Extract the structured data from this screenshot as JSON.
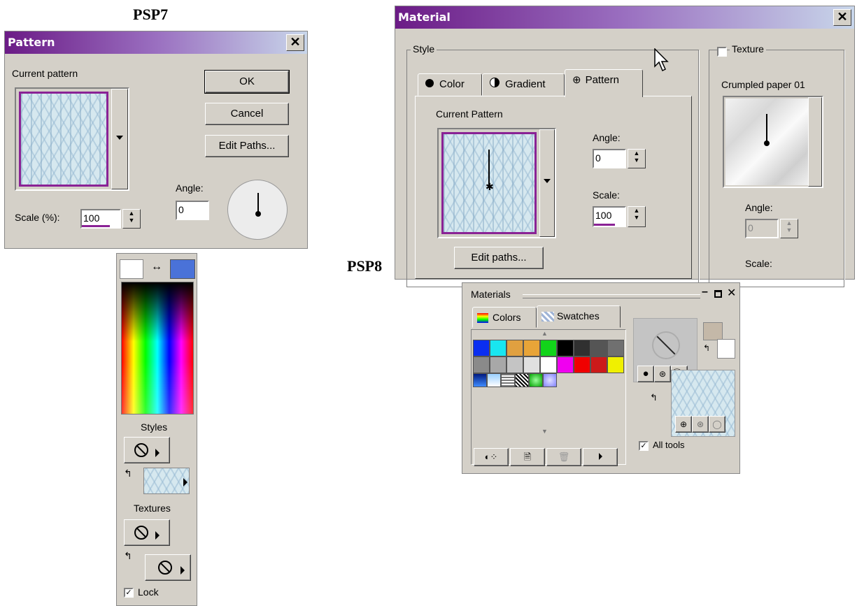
{
  "captions": {
    "psp7": "PSP7",
    "psp8": "PSP8"
  },
  "pattern_dialog": {
    "title": "Pattern",
    "current_pattern_label": "Current pattern",
    "ok": "OK",
    "cancel": "Cancel",
    "edit_paths": "Edit Paths...",
    "angle_label": "Angle:",
    "angle_value": "0",
    "scale_label": "Scale (%):",
    "scale_value": "100"
  },
  "psp7_palette": {
    "swap_icon": "↔",
    "styles_label": "Styles",
    "textures_label": "Textures",
    "lock_label": "Lock",
    "lock_checked": true,
    "fg_color": "#ffffff",
    "bg_color": "#4a72d8"
  },
  "material_dialog": {
    "title": "Material",
    "style_group": "Style",
    "tabs": [
      "Color",
      "Gradient",
      "Pattern"
    ],
    "active_tab": "Pattern",
    "current_pattern_label": "Current Pattern",
    "angle_label": "Angle:",
    "angle_value": "0",
    "scale_label": "Scale:",
    "scale_value": "100",
    "edit_paths": "Edit paths...",
    "texture_label": "Texture",
    "texture_checked": false,
    "texture_name": "Crumpled paper 01",
    "texture_angle_label": "Angle:",
    "texture_angle_value": "0",
    "texture_scale_label": "Scale:"
  },
  "materials_palette": {
    "title": "Materials",
    "tabs": [
      "Colors",
      "Swatches"
    ],
    "active_tab": "Swatches",
    "all_tools_label": "All tools",
    "all_tools_checked": true,
    "swatch_rows": [
      [
        "#0a2ef0",
        "#19e6f0",
        "#e0a040",
        "#e8a438",
        "#12d41a",
        "#000000",
        "#303030",
        "#555555",
        "#707070"
      ],
      [
        "#8a8a8a",
        "#a8a8a8",
        "#c4c4c4",
        "#e0e0e0",
        "#ffffff",
        "#f000f0",
        "#f00000",
        "#cc1a1a",
        "#f0f000"
      ]
    ]
  }
}
